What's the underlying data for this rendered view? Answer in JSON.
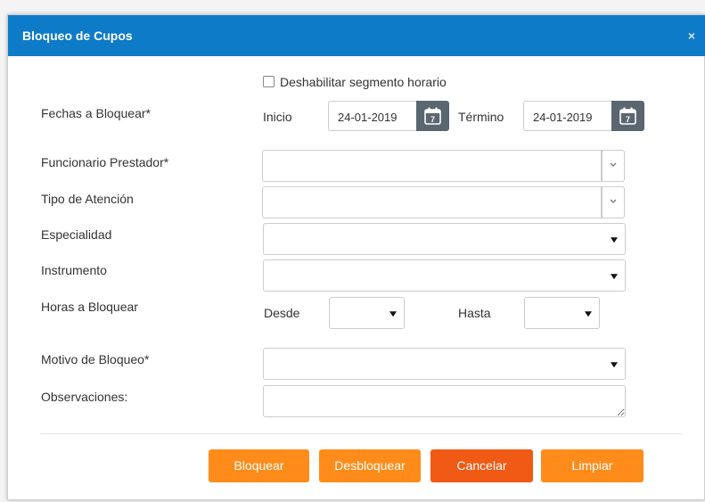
{
  "dialog": {
    "title": "Bloqueo de Cupos",
    "close_symbol": "×"
  },
  "form": {
    "disable_segment_label": "Deshabilitar segmento horario",
    "disable_segment_checked": false,
    "fechas_label": "Fechas a Bloquear*",
    "inicio_label": "Inicio",
    "inicio_value": "24-01-2019",
    "termino_label": "Término",
    "termino_value": "24-01-2019",
    "calendar_day": "7",
    "funcionario_label": "Funcionario Prestador*",
    "funcionario_value": "",
    "tipo_label": "Tipo de Atención",
    "tipo_value": "",
    "especialidad_label": "Especialidad",
    "instrumento_label": "Instrumento",
    "horas_label": "Horas a Bloquear",
    "desde_label": "Desde",
    "hasta_label": "Hasta",
    "motivo_label": "Motivo de Bloqueo*",
    "observaciones_label": "Observaciones:",
    "observaciones_value": ""
  },
  "buttons": {
    "bloquear": "Bloquear",
    "desbloquear": "Desbloquear",
    "cancelar": "Cancelar",
    "limpiar": "Limpiar"
  },
  "colors": {
    "header": "#0e7bc8",
    "primary_button": "#ff8c1a",
    "cancel_button": "#f05a14",
    "calendar_button": "#5a6670"
  },
  "icons": [
    "close-icon",
    "calendar-icon",
    "chevron-down-icon",
    "caret-down-icon",
    "resize-handle-icon"
  ]
}
